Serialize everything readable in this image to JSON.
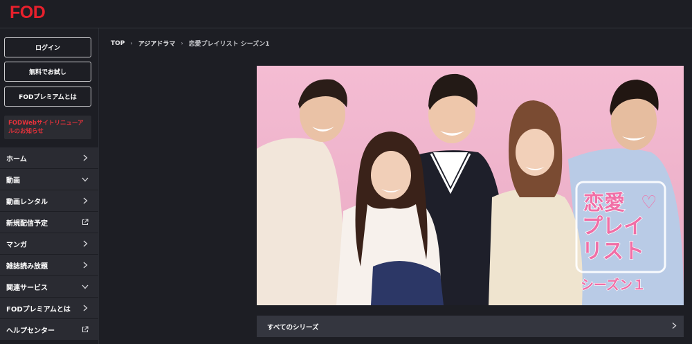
{
  "header": {
    "logo": "FOD"
  },
  "sidebar": {
    "login_label": "ログイン",
    "trial_label": "無料でお試し",
    "premium_label": "FODプレミアムとは",
    "news_text": "FODWebサイトリニューアルのお知らせ",
    "menu": [
      {
        "label": "ホーム",
        "icon": "chevron-right-icon"
      },
      {
        "label": "動画",
        "icon": "chevron-down-icon"
      },
      {
        "label": "動画レンタル",
        "icon": "chevron-right-icon"
      },
      {
        "label": "新規配信予定",
        "icon": "external-link-icon"
      },
      {
        "label": "マンガ",
        "icon": "chevron-right-icon"
      },
      {
        "label": "雑誌読み放題",
        "icon": "chevron-right-icon"
      },
      {
        "label": "関連サービス",
        "icon": "chevron-down-icon"
      },
      {
        "label": "FODプレミアムとは",
        "icon": "chevron-right-icon"
      },
      {
        "label": "ヘルプセンター",
        "icon": "external-link-icon"
      }
    ]
  },
  "breadcrumb": {
    "items": [
      "TOP",
      "アジアドラマ",
      "恋愛プレイリスト シーズン1"
    ]
  },
  "hero": {
    "title_line1": "恋愛",
    "title_line2": "プレイ",
    "title_line3": "リスト",
    "season": "シーズン１"
  },
  "series_bar": {
    "label": "すべてのシリーズ"
  },
  "colors": {
    "brand": "#e8202c",
    "background": "#1d1e24",
    "menu_bg": "#2a2b32",
    "hero_pink": "#f1b8d0",
    "title_pink": "#f06fa6"
  }
}
